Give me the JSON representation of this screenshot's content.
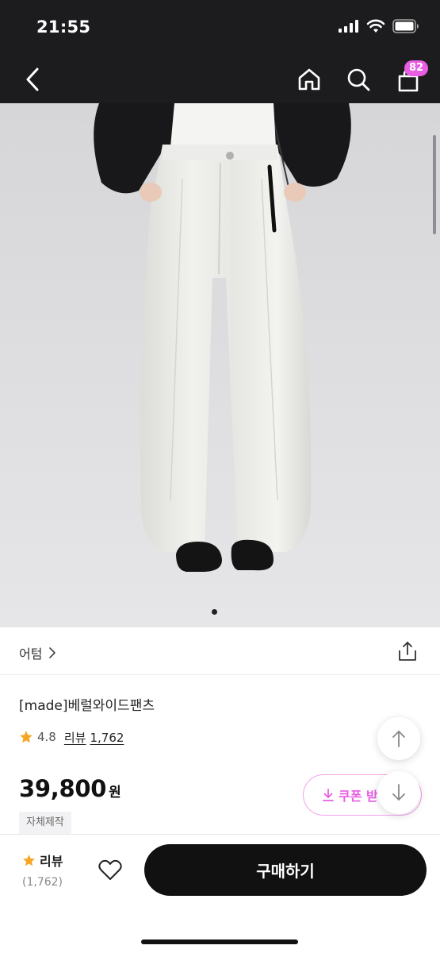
{
  "status_bar": {
    "time": "21:55"
  },
  "nav": {
    "cart_count": "82"
  },
  "brand": {
    "name": "어텀"
  },
  "product": {
    "title": "[made]베럴와이드팬츠",
    "rating": "4.8",
    "review_label": "리뷰",
    "review_count": "1,762",
    "price": "39,800",
    "price_unit": "원",
    "tag": "자체제작"
  },
  "coupon": {
    "label": "쿠폰 받"
  },
  "bottom_bar": {
    "review_label": "리뷰",
    "review_count": "(1,762)",
    "buy_label": "구매하기"
  },
  "colors": {
    "accent": "#e85de3",
    "rating_star": "#f5a623",
    "dark": "#1c1c1e"
  },
  "icons": [
    "back-icon",
    "home-icon",
    "search-icon",
    "cart-icon",
    "share-icon",
    "star-icon",
    "arrow-up-icon",
    "arrow-down-icon",
    "download-icon",
    "heart-icon"
  ]
}
